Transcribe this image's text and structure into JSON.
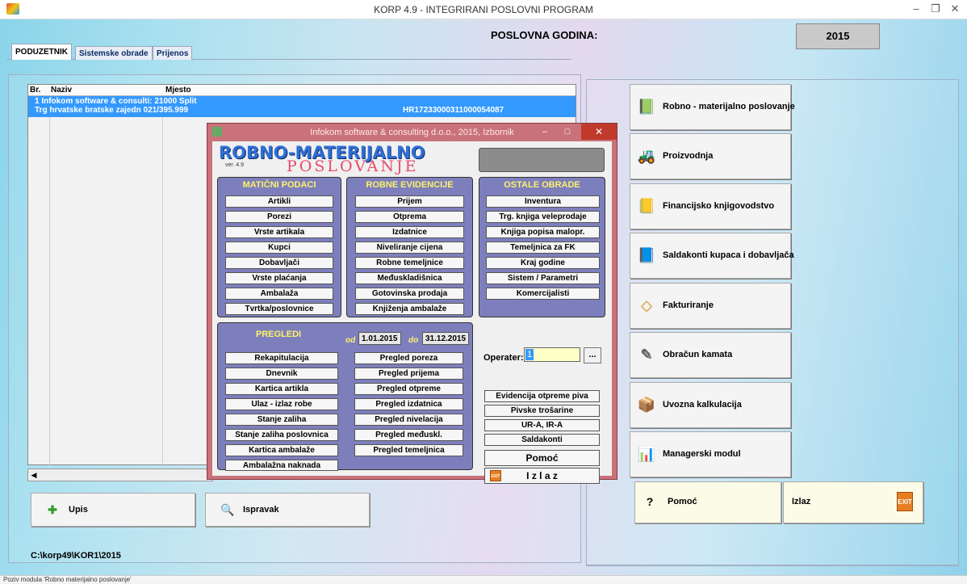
{
  "window": {
    "title": "KORP 4.9 - INTEGRIRANI POSLOVNI PROGRAM",
    "min_label": "–",
    "max_label": "❐",
    "close_label": "✕"
  },
  "header": {
    "poslovna_label": "POSLOVNA GODINA:",
    "godina_value": "2015"
  },
  "tabs": [
    {
      "label": "PODUZETNIK"
    },
    {
      "label": "Sistemske obrade"
    },
    {
      "label": "Prijenos"
    }
  ],
  "grid": {
    "columns": [
      "Br.",
      "Naziv",
      "Mjesto"
    ],
    "row1": {
      "line1": "1 Infokom software & consulti: 21000 Split",
      "line2": "Trg hrvatske  bratske zajedn 021/395.999",
      "oib": "HR17233000311000054087"
    }
  },
  "bottom_buttons": {
    "upis": "Upis",
    "ispravak": "Ispravak"
  },
  "path": "C:\\korp49\\KOR1\\2015",
  "modules": [
    {
      "label": "Robno - materijalno poslovanje",
      "icon": "book-icon"
    },
    {
      "label": "Proizvodnja",
      "icon": "forklift-icon"
    },
    {
      "label": "Financijsko knjigovodstvo",
      "icon": "ledger-icon"
    },
    {
      "label": "Saldakonti   kupaca i dobavljača",
      "icon": "blue-book-icon"
    },
    {
      "label": "Fakturiranje",
      "icon": "eraser-icon"
    },
    {
      "label": "Obračun kamata",
      "icon": "pen-icon"
    },
    {
      "label": "Uvozna kalkulacija",
      "icon": "box-icon"
    },
    {
      "label": "Managerski modul",
      "icon": "chart-icon"
    }
  ],
  "right_bottom": {
    "pomoc": "Pomoć",
    "izlaz": "Izlaz"
  },
  "dialog": {
    "title": "Infokom software & consulting d.o.o., 2015, Izbornik",
    "logo_line1": "ROBNO-MATERIJALNO",
    "logo_line2": "POSLOVANJE",
    "logo_ver": "ver. 4.9",
    "maticni": {
      "head": "MATIČNI PODACI",
      "items": [
        "Artikli",
        "Porezi",
        "Vrste artikala",
        "Kupci",
        "Dobavljači",
        "Vrste plaćanja",
        "Ambalaža",
        "Tvrtka/poslovnice"
      ]
    },
    "robne": {
      "head": "ROBNE EVIDENCIJE",
      "items": [
        "Prijem",
        "Otprema",
        "Izdatnice",
        "Niveliranje cijena",
        "Robne temeljnice",
        "Međuskladišnica",
        "Gotovinska prodaja",
        "Knjiženja ambalaže"
      ]
    },
    "ostale": {
      "head": "OSTALE OBRADE",
      "items": [
        "Inventura",
        "Trg. knjiga veleprodaje",
        "Knjiga popisa malopr.",
        "Temeljnica za FK",
        "Kraj godine",
        "Sistem / Parametri",
        "Komercijalisti"
      ]
    },
    "pregledi": {
      "head": "PREGLEDI",
      "od_label": "od",
      "od_value": "1.01.2015",
      "do_label": "do",
      "do_value": "31.12.2015",
      "col1": [
        "Rekapitulacija",
        "Dnevnik",
        "Kartica artikla",
        "Ulaz - izlaz robe",
        "Stanje zaliha",
        "Stanje zaliha poslovnica",
        "Kartica ambalaže",
        "Ambalažna naknada"
      ],
      "col2": [
        "Pregled poreza",
        "Pregled prijema",
        "Pregled otpreme",
        "Pregled izdatnica",
        "Pregled nivelacija",
        "Pregled međuskl.",
        "Pregled temeljnica"
      ]
    },
    "operater_label": "Operater:",
    "operater_value": "1",
    "operater_btn": "...",
    "side_buttons": [
      "Evidencija otpreme piva",
      "Pivske trošarine",
      "UR-A, IR-A",
      "Saldakonti"
    ],
    "pomoc": "Pomoć",
    "izlaz": "I z l a z"
  },
  "statusbar": "Poziv modula 'Robno materijalno poslovanje'"
}
